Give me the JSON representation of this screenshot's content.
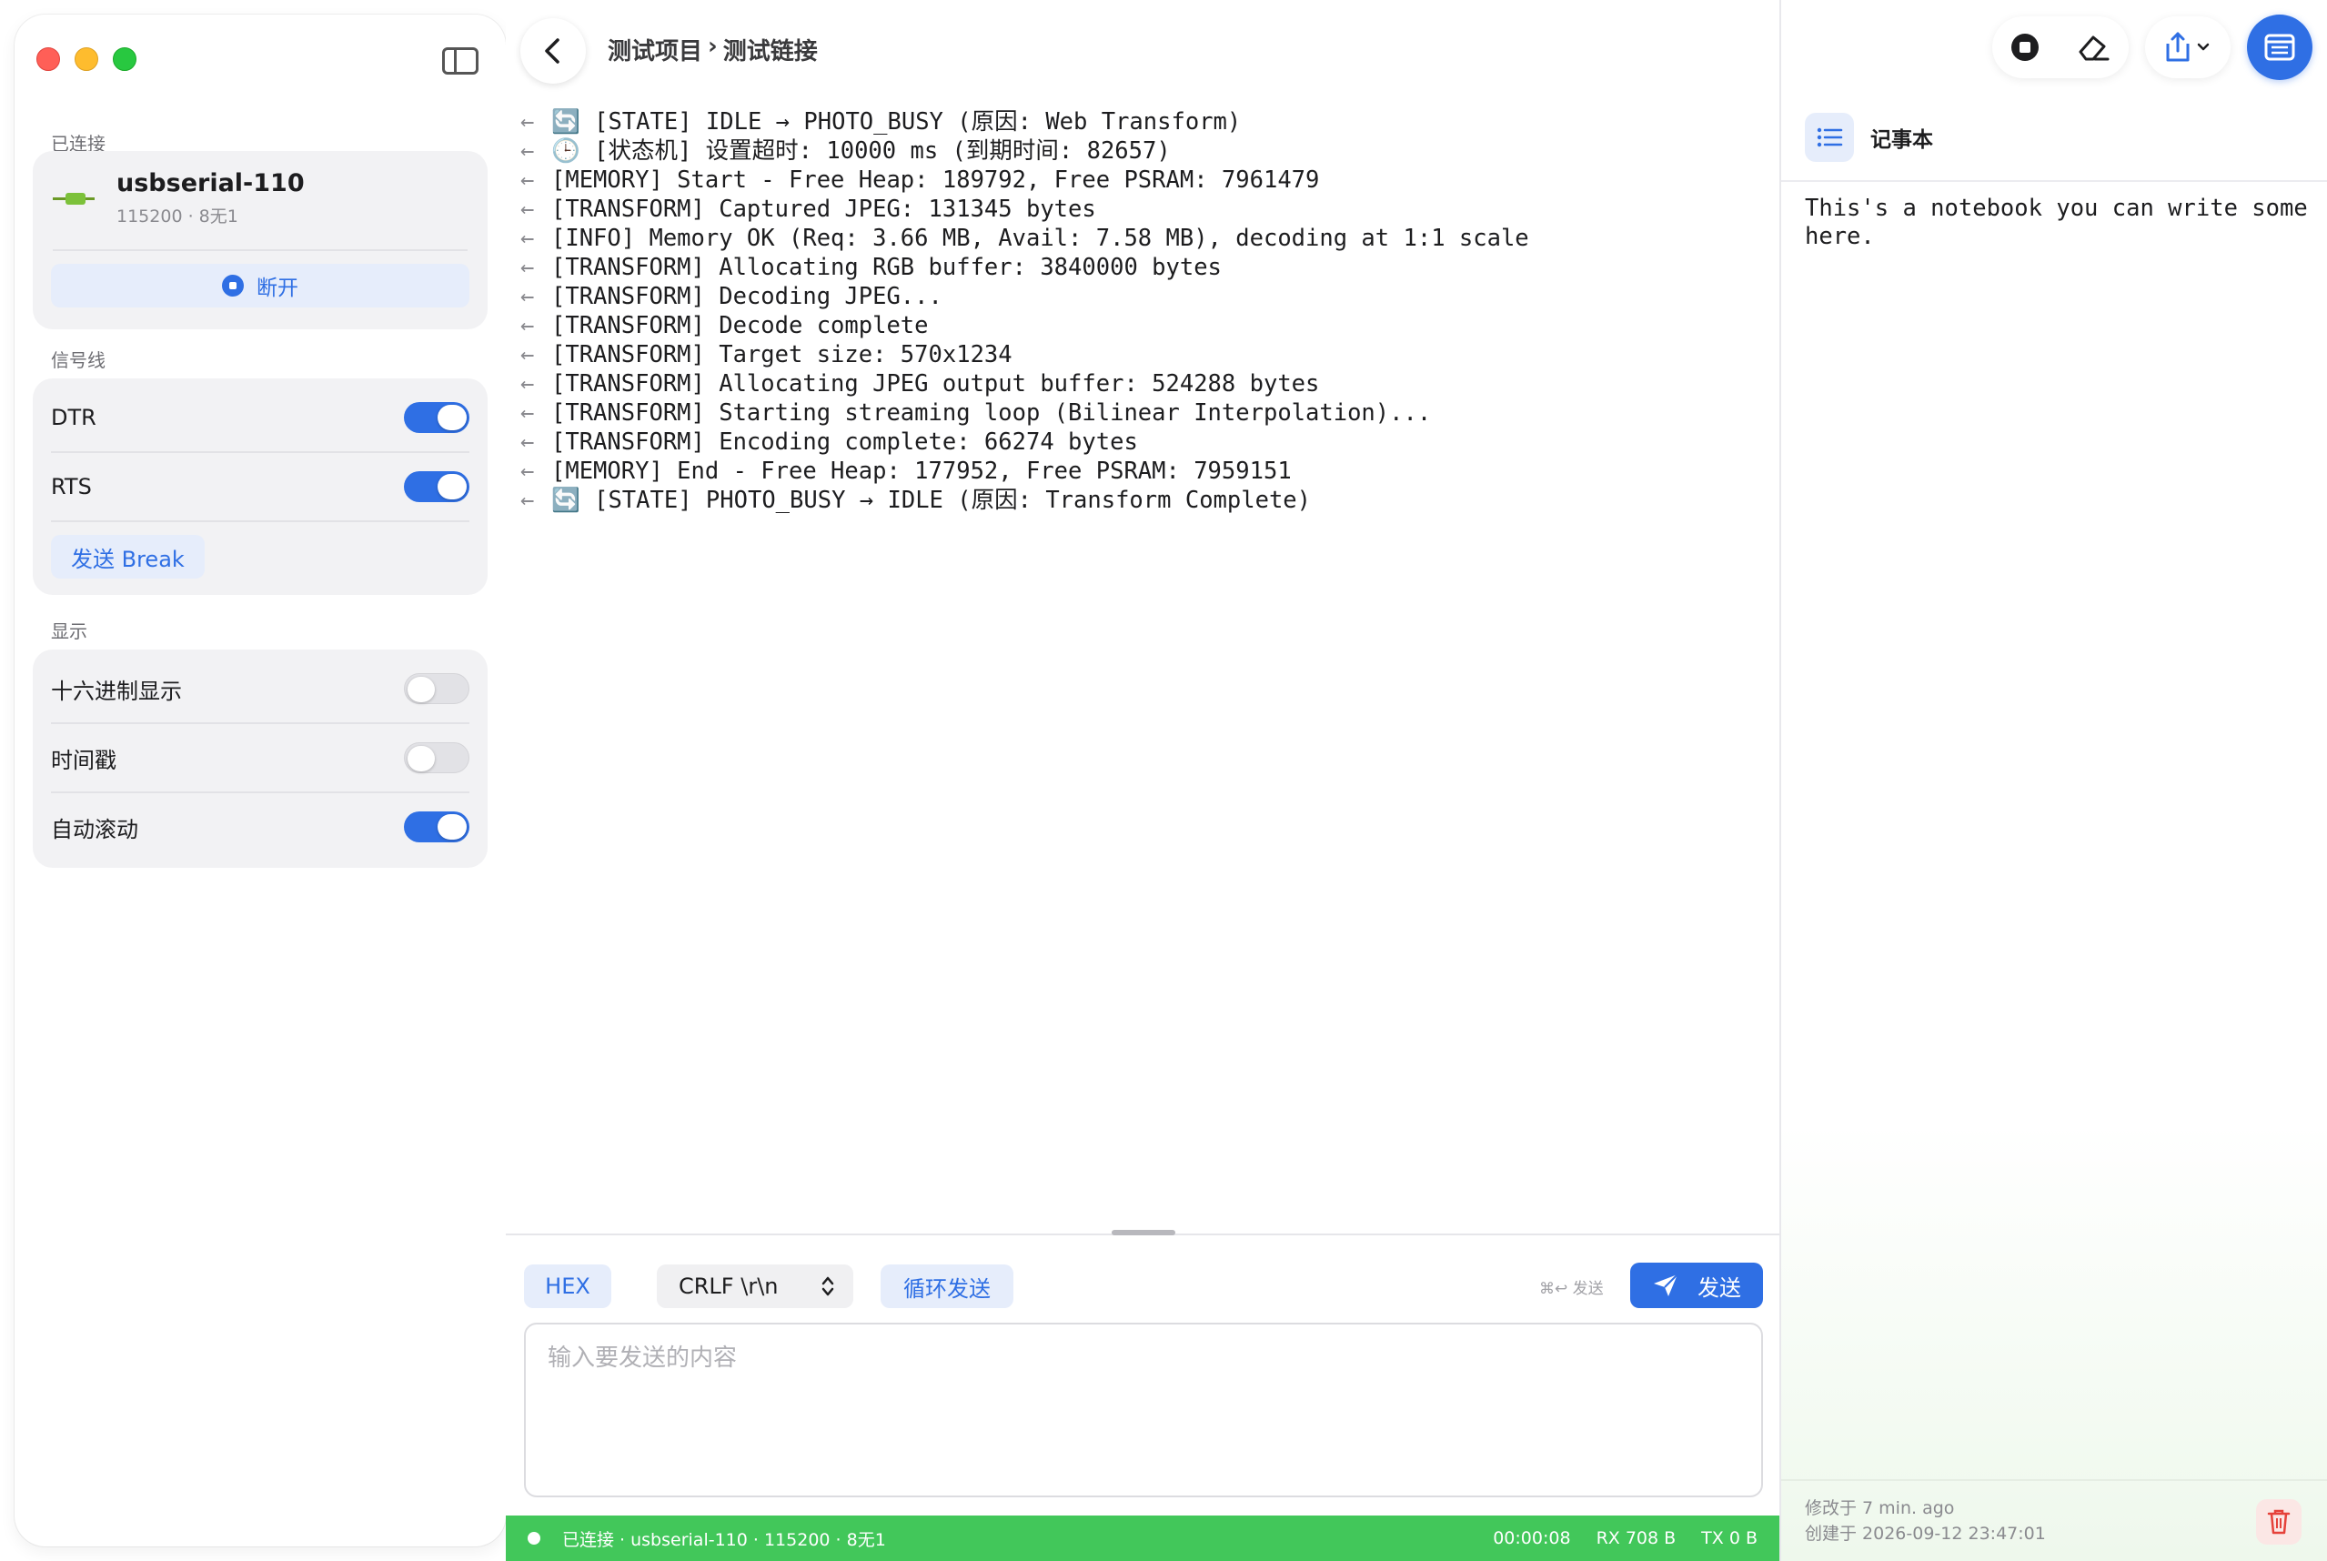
{
  "sidebar": {
    "connected_label": "已连接",
    "device": {
      "name": "usbserial-110",
      "params": "115200 · 8无1"
    },
    "disconnect_label": "断开",
    "signals_label": "信号线",
    "signals": [
      {
        "label": "DTR",
        "on": true
      },
      {
        "label": "RTS",
        "on": true
      }
    ],
    "break_label": "发送 Break",
    "display_label": "显示",
    "display_options": [
      {
        "label": "十六进制显示",
        "on": false
      },
      {
        "label": "时间戳",
        "on": false
      },
      {
        "label": "自动滚动",
        "on": true
      }
    ]
  },
  "main": {
    "breadcrumb": {
      "project": "测试项目",
      "separator": "›",
      "link": "测试链接"
    },
    "log_lines": [
      "🔄 [STATE] IDLE → PHOTO_BUSY (原因: Web Transform)",
      "🕒 [状态机] 设置超时: 10000 ms (到期时间: 82657)",
      "[MEMORY] Start - Free Heap: 189792, Free PSRAM: 7961479",
      "[TRANSFORM] Captured JPEG: 131345 bytes",
      "[INFO] Memory OK (Req: 3.66 MB, Avail: 7.58 MB), decoding at 1:1 scale",
      "[TRANSFORM] Allocating RGB buffer: 3840000 bytes",
      "[TRANSFORM] Decoding JPEG...",
      "[TRANSFORM] Decode complete",
      "[TRANSFORM] Target size: 570x1234",
      "[TRANSFORM] Allocating JPEG output buffer: 524288 bytes",
      "[TRANSFORM] Starting streaming loop (Bilinear Interpolation)...",
      "[TRANSFORM] Encoding complete: 66274 bytes",
      "[MEMORY] End - Free Heap: 177952, Free PSRAM: 7959151",
      "🔄 [STATE] PHOTO_BUSY → IDLE (原因: Transform Complete)"
    ],
    "log_arrow": "←",
    "hex_label": "HEX",
    "line_ending": "CRLF  \\r\\n",
    "loop_label": "循环发送",
    "shortcut_hint": "⌘↩ 发送",
    "send_label": "发送",
    "input_placeholder": "输入要发送的内容"
  },
  "statusbar": {
    "connection": "已连接 · usbserial-110 · 115200 · 8无1",
    "elapsed": "00:00:08",
    "rx": "RX 708 B",
    "tx": "TX 0 B"
  },
  "notebook": {
    "title": "记事本",
    "content": "This's a notebook you can write some here.",
    "modified": "修改于 7 min. ago",
    "created": "创建于 2026-09-12 23:47:01"
  },
  "colors": {
    "accent": "#2f6fe4",
    "status_bar": "#42c75a",
    "danger": "#e5423a"
  }
}
